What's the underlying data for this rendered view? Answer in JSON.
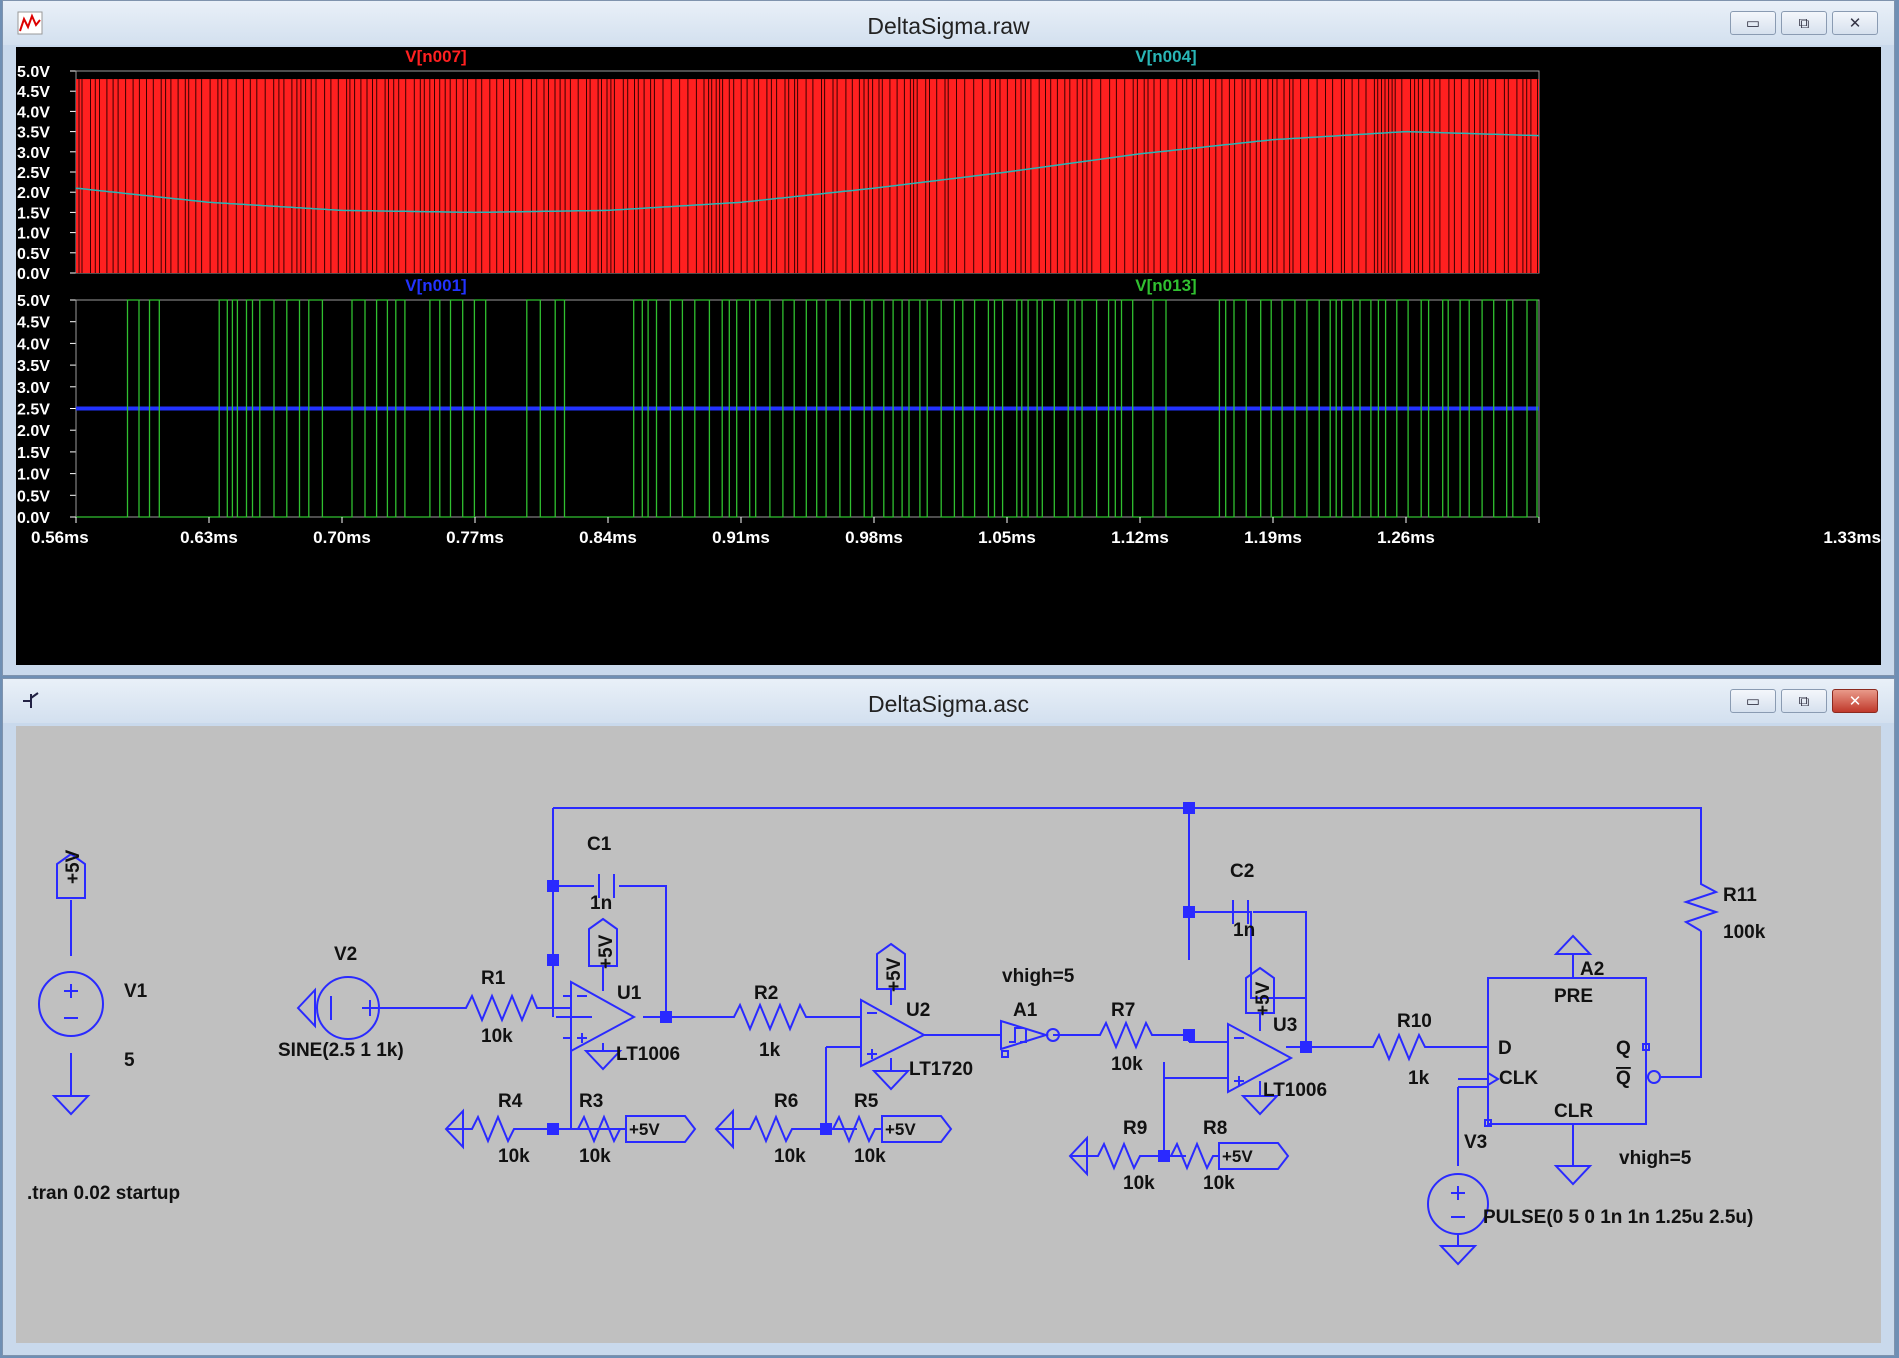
{
  "plot_window": {
    "title": "DeltaSigma.raw",
    "icon": "waveform-icon",
    "controls": [
      "minimize-icon",
      "maximize-icon",
      "close-icon"
    ]
  },
  "schematic_window": {
    "title": "DeltaSigma.asc",
    "icon": "schematic-icon",
    "controls": [
      "minimize-icon",
      "maximize-icon",
      "close-icon"
    ]
  },
  "chart_data": [
    {
      "type": "line",
      "series": [
        {
          "name": "V[n007]",
          "color": "#ff2020",
          "shape": "pwm square wave 0V to 4.8V"
        },
        {
          "name": "V[n004]",
          "color": "#29b6b6",
          "x": [
            0.56,
            0.63,
            0.7,
            0.77,
            0.84,
            0.91,
            0.98,
            1.05,
            1.12,
            1.19,
            1.26,
            1.33
          ],
          "values": [
            2.1,
            1.75,
            1.55,
            1.5,
            1.55,
            1.75,
            2.1,
            2.5,
            2.95,
            3.3,
            3.5,
            3.4
          ]
        }
      ],
      "ylim": [
        0,
        5
      ],
      "yticks": [
        "5.0V",
        "4.5V",
        "4.0V",
        "3.5V",
        "3.0V",
        "2.5V",
        "2.0V",
        "1.5V",
        "1.0V",
        "0.5V",
        "0.0V"
      ]
    },
    {
      "type": "line",
      "series": [
        {
          "name": "V[n001]",
          "color": "#2233ff",
          "constant": 2.5
        },
        {
          "name": "V[n013]",
          "color": "#30c030",
          "shape": "pulse train 0V to 5V"
        }
      ],
      "ylim": [
        0,
        5
      ],
      "yticks": [
        "5.0V",
        "4.5V",
        "4.0V",
        "3.5V",
        "3.0V",
        "2.5V",
        "2.0V",
        "1.5V",
        "1.0V",
        "0.5V",
        "0.0V"
      ],
      "xlim": [
        0.56,
        1.33
      ],
      "xticks": [
        "0.56ms",
        "0.63ms",
        "0.70ms",
        "0.77ms",
        "0.84ms",
        "0.91ms",
        "0.98ms",
        "1.05ms",
        "1.12ms",
        "1.19ms",
        "1.26ms",
        "1.33ms"
      ]
    }
  ],
  "schematic": {
    "v1": {
      "name": "V1",
      "value": "5"
    },
    "v2": {
      "name": "V2",
      "value": "SINE(2.5 1 1k)"
    },
    "v3": {
      "name": "V3",
      "value": "PULSE(0 5 0 1n 1n 1.25u 2.5u)"
    },
    "r1": {
      "name": "R1",
      "value": "10k"
    },
    "r2": {
      "name": "R2",
      "value": "1k"
    },
    "r3": {
      "name": "R3",
      "value": "10k"
    },
    "r4": {
      "name": "R4",
      "value": "10k"
    },
    "r5": {
      "name": "R5",
      "value": "10k"
    },
    "r6": {
      "name": "R6",
      "value": "10k"
    },
    "r7": {
      "name": "R7",
      "value": "10k"
    },
    "r8": {
      "name": "R8",
      "value": "10k"
    },
    "r9": {
      "name": "R9",
      "value": "10k"
    },
    "r10": {
      "name": "R10",
      "value": "1k"
    },
    "r11": {
      "name": "R11",
      "value": "100k"
    },
    "c1": {
      "name": "C1",
      "value": "1n"
    },
    "c2": {
      "name": "C2",
      "value": "1n"
    },
    "u1": {
      "name": "U1",
      "part": "LT1006"
    },
    "u2": {
      "name": "U2",
      "part": "LT1720"
    },
    "u3": {
      "name": "U3",
      "part": "LT1006"
    },
    "a1": {
      "name": "A1",
      "param": "vhigh=5"
    },
    "a2": {
      "name": "A2",
      "param": "vhigh=5",
      "pins": {
        "d": "D",
        "pre": "PRE",
        "clk": "CLK",
        "clr": "CLR",
        "q": "Q",
        "qbar": "Q"
      }
    },
    "supply_label": "+5V",
    "directive": ".tran 0.02 startup"
  }
}
